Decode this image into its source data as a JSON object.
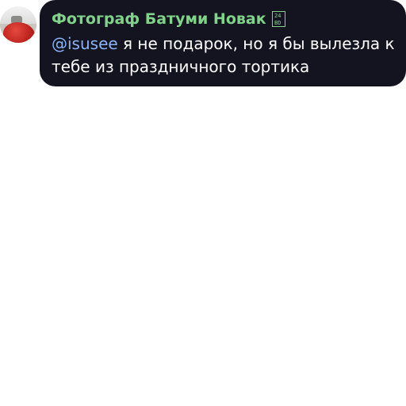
{
  "message": {
    "author": "Фотограф Батуми Новак",
    "author_badge_icon": "unknown-glyph-icon",
    "mention": "@isusee",
    "text": " я не подарок, но я бы вылезла к тебе из праздничного тортика",
    "colors": {
      "bubble_background": "#141421",
      "author_name": "#7fd48a",
      "mention": "#8ab4f8",
      "text": "#ffffff"
    }
  }
}
